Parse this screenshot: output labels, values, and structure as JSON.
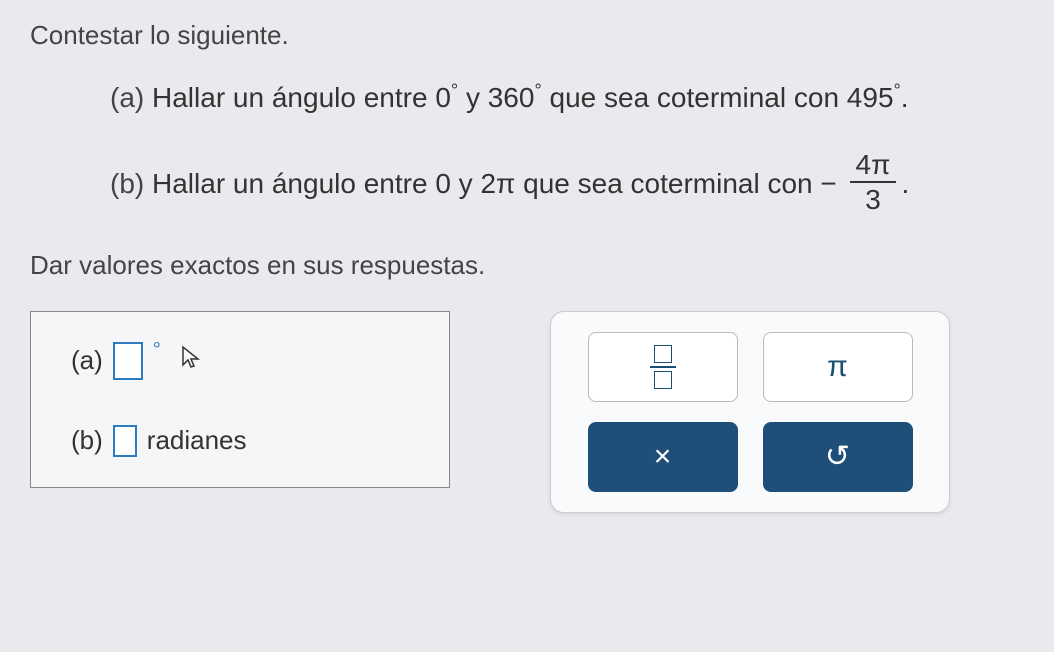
{
  "instruction": "Contestar lo siguiente.",
  "question_a": {
    "label": "(a)",
    "text_before": " Hallar un ángulo entre ",
    "range_start": "0",
    "range_mid": " y ",
    "range_end": "360",
    "text_after": " que sea coterminal con ",
    "value": "495",
    "end": "."
  },
  "question_b": {
    "label": "(b)",
    "text_before": " Hallar un ángulo entre ",
    "range_start": "0",
    "range_mid": " y ",
    "range_end": "2π",
    "text_after": " que sea coterminal con ",
    "minus": "−",
    "frac_num": "4π",
    "frac_den": "3",
    "end": "."
  },
  "hint": "Dar valores exactos en sus respuestas.",
  "answers": {
    "a_label": "(a)",
    "a_unit_symbol": "°",
    "b_label": "(b)",
    "b_unit": "radianes"
  },
  "toolbox": {
    "pi": "π",
    "clear": "×",
    "reset": "↺"
  }
}
